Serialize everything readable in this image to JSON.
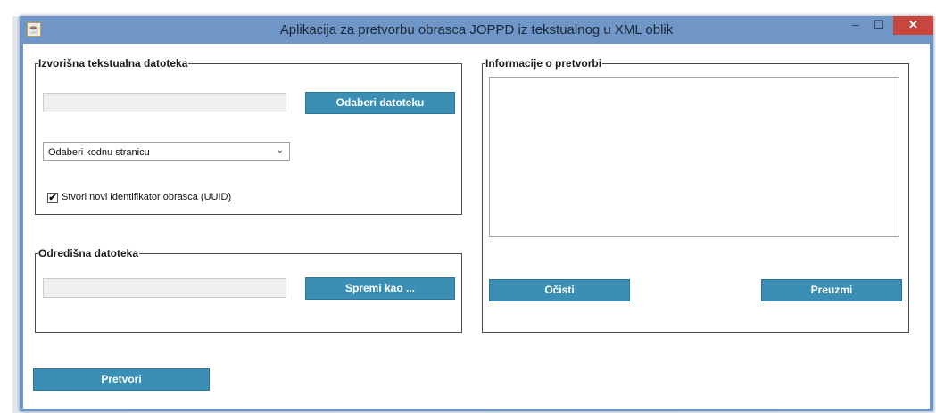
{
  "window": {
    "title": "Aplikacija za pretvorbu obrasca JOPPD iz tekstualnog u XML oblik",
    "app_icon": "java-icon",
    "controls": {
      "minimize": "–",
      "maximize": "☐",
      "close": "✕"
    }
  },
  "source": {
    "legend": "Izvorišna tekstualna datoteka",
    "file_path": "",
    "choose_button": "Odaberi datoteku",
    "codepage_select": "Odaberi kodnu stranicu",
    "uuid_checkbox_label": "Stvori novi identifikator obrasca (UUID)",
    "uuid_checked": true
  },
  "destination": {
    "legend": "Odredišna datoteka",
    "file_path": "",
    "save_button": "Spremi kao ..."
  },
  "info": {
    "legend": "Informacije o pretvorbi",
    "text": "",
    "clear_button": "Očisti",
    "download_button": "Preuzmi"
  },
  "convert_button": "Pretvori",
  "colors": {
    "titlebar": "#6f96c7",
    "button": "#3b8fb4",
    "close": "#c7463d"
  }
}
